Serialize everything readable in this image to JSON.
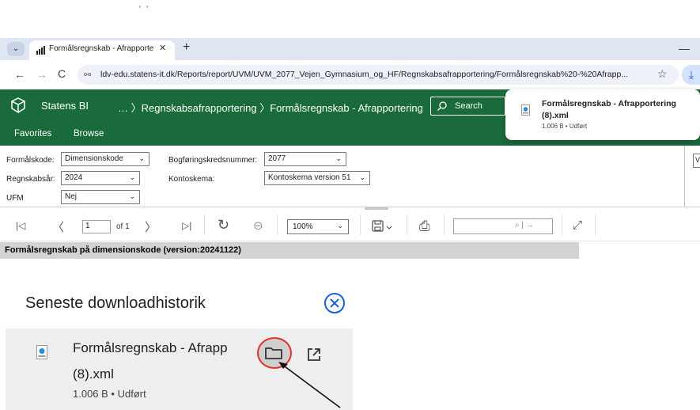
{
  "top_marks": "' '",
  "browser": {
    "tab": {
      "title": "Formålsregnskab - Afrapportering",
      "close_glyph": "✕",
      "new_tab_glyph": "+"
    },
    "tab_dropdown_glyph": "⌄",
    "minimize_glyph": "—",
    "nav": {
      "back": "←",
      "forward": "→",
      "reload": "C"
    },
    "url": "ldv-edu.statens-it.dk/Reports/report/UVM/UVM_2077_Vejen_Gymnasium_og_HF/Regnskabsafrapportering/Formålsregnskab%20-%20Afrapp...",
    "site_info_glyph": "⚯",
    "star_glyph": "☆",
    "download_glyph": "⤓"
  },
  "app": {
    "brand": "Statens BI",
    "breadcrumb": "… 〉Regnskabsafrapportering 〉Formålsregnskab - Afrapportering",
    "search_label": "Search",
    "menu": {
      "favorites": "Favorites",
      "browse": "Browse"
    },
    "brand_color": "#1a6b3c"
  },
  "download_popup": {
    "name": "Formålsregnskab - Afrapportering (8).xml",
    "meta": "1.006 B • Udført"
  },
  "params": {
    "formalskode": {
      "label": "Formålskode:",
      "value": "Dimensionskode"
    },
    "regnskabsar": {
      "label": "Regnskabsår:",
      "value": "2024"
    },
    "ufm": {
      "label": "UFM",
      "value": "Nej"
    },
    "bogforing": {
      "label": "Bogføringskredsnummer:",
      "value": "2077"
    },
    "kontoskema": {
      "label": "Kontoskema:",
      "value": "Kontoskema version 51"
    },
    "view_label": "V"
  },
  "toolbar": {
    "first": "|◁",
    "prev": "〈",
    "page": "1",
    "of": "of 1",
    "next": "〉",
    "last": "▷|",
    "refresh": "↻",
    "back": "⊖",
    "zoom": "100%",
    "find_icons": "⌕ | →",
    "print": "⎙",
    "fullscreen": "⤢"
  },
  "report": {
    "title": "Formålsregnskab på dimensionskode (version:20241122)"
  },
  "history": {
    "title": "Seneste downloadhistorik",
    "item_name": "Formålsregnskab - Afrapp",
    "item_name_2": "(8).xml",
    "item_meta": "1.006 B • Udført"
  },
  "colors": {
    "highlight_ring": "#e0302a",
    "close_blue": "#1a5fd8"
  }
}
